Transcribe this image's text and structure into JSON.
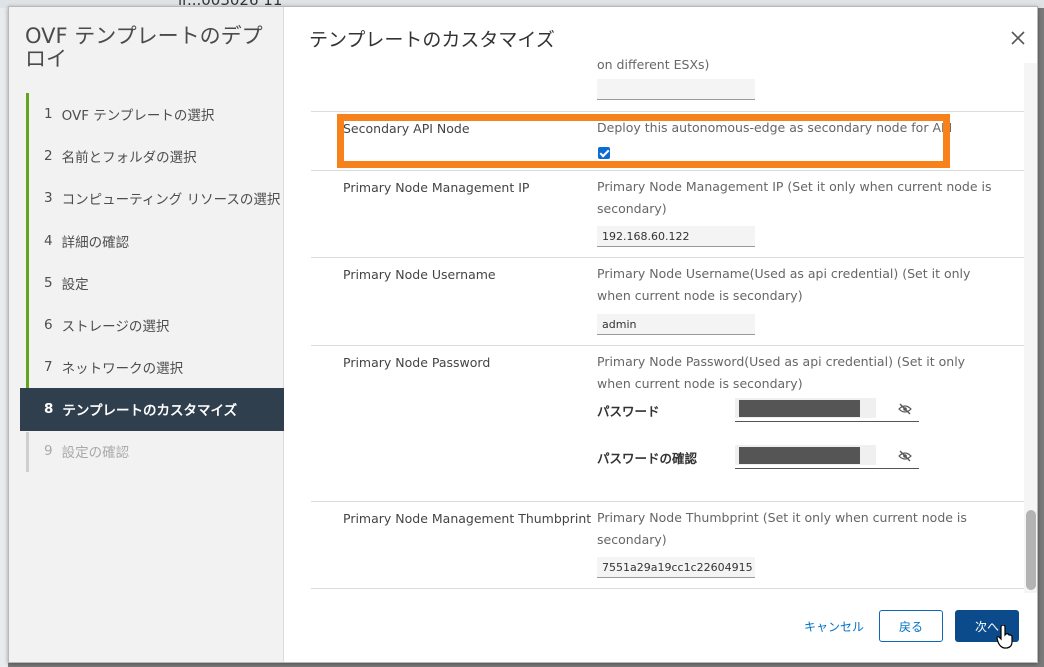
{
  "background": {
    "window_title": "ir...003026 11"
  },
  "wizard": {
    "title": "OVF テンプレートのデプロイ",
    "steps": [
      {
        "num": "1",
        "label": "OVF テンプレートの選択"
      },
      {
        "num": "2",
        "label": "名前とフォルダの選択"
      },
      {
        "num": "3",
        "label": "コンピューティング リソースの選択"
      },
      {
        "num": "4",
        "label": "詳細の確認"
      },
      {
        "num": "5",
        "label": "設定"
      },
      {
        "num": "6",
        "label": "ストレージの選択"
      },
      {
        "num": "7",
        "label": "ネットワークの選択"
      },
      {
        "num": "8",
        "label": "テンプレートのカスタマイズ"
      },
      {
        "num": "9",
        "label": "設定の確認"
      }
    ],
    "active_step": 8
  },
  "main": {
    "title": "テンプレートのカスタマイズ",
    "prev_row_desc_tail": "on different ESXs)",
    "rows": {
      "secondary_api": {
        "label": "Secondary API Node",
        "desc": "Deploy this autonomous-edge as secondary node for API",
        "checked": true
      },
      "primary_ip": {
        "label": "Primary Node Management IP",
        "desc": "Primary Node Management IP (Set it only when current node is secondary)",
        "value": "192.168.60.122"
      },
      "primary_user": {
        "label": "Primary Node Username",
        "desc": "Primary Node Username(Used as api credential) (Set it only when current node is secondary)",
        "value": "admin"
      },
      "primary_pass": {
        "label": "Primary Node Password",
        "desc": "Primary Node Password(Used as api credential) (Set it only when current node is secondary)",
        "password_label": "パスワード",
        "confirm_label": "パスワードの確認"
      },
      "thumbprint": {
        "label": "Primary Node Management Thumbprint",
        "desc": "Primary Node Thumbprint (Set it only when current node is secondary)",
        "value": "7551a29a19cc1c22604915"
      }
    }
  },
  "footer": {
    "cancel": "キャンセル",
    "back": "戻る",
    "next": "次へ"
  },
  "colors": {
    "highlight": "#f7821b",
    "active_step_bg": "#2f3f4d",
    "progress_green": "#62a420",
    "primary_button": "#0b4b8c",
    "link_blue": "#0072c6"
  },
  "icons": [
    "close-icon",
    "eye-slash-icon",
    "checkbox-checked-icon",
    "hand-pointer-icon"
  ]
}
